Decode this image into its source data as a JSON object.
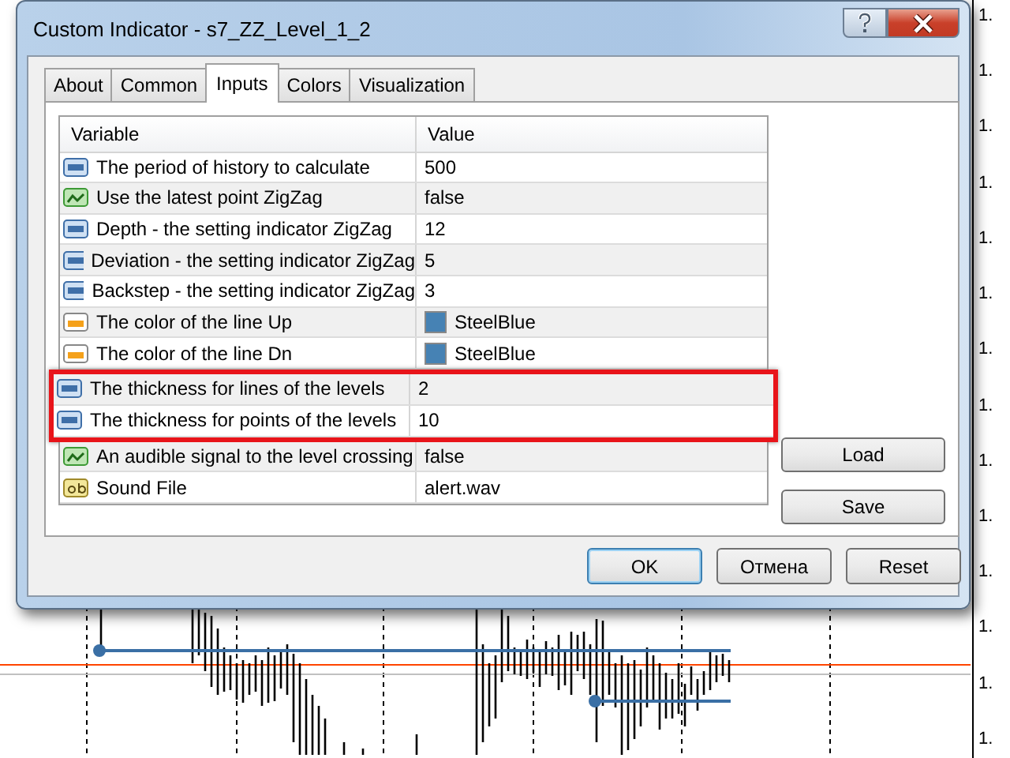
{
  "window": {
    "title": "Custom Indicator - s7_ZZ_Level_1_2"
  },
  "tabs": [
    {
      "label": "About",
      "selected": false
    },
    {
      "label": "Common",
      "selected": false
    },
    {
      "label": "Inputs",
      "selected": true
    },
    {
      "label": "Colors",
      "selected": false
    },
    {
      "label": "Visualization",
      "selected": false
    }
  ],
  "table": {
    "columns": [
      "Variable",
      "Value"
    ],
    "rows": [
      {
        "kind": "number",
        "variable": "The period of history to calculate",
        "value": "500",
        "highlighted": false
      },
      {
        "kind": "bool",
        "variable": "Use the latest point ZigZag",
        "value": "false",
        "highlighted": false
      },
      {
        "kind": "number",
        "variable": "Depth - the setting indicator ZigZag",
        "value": "12",
        "highlighted": false
      },
      {
        "kind": "number",
        "variable": "Deviation - the setting indicator ZigZag",
        "value": "5",
        "highlighted": false
      },
      {
        "kind": "number",
        "variable": "Backstep - the setting indicator ZigZag",
        "value": "3",
        "highlighted": false
      },
      {
        "kind": "color",
        "variable": "The color of the line Up",
        "value": "SteelBlue",
        "color": "#4682b4",
        "highlighted": false
      },
      {
        "kind": "color",
        "variable": "The color of the line Dn",
        "value": "SteelBlue",
        "color": "#4682b4",
        "highlighted": false
      },
      {
        "kind": "number",
        "variable": "The thickness for lines of the levels",
        "value": "2",
        "highlighted": true
      },
      {
        "kind": "number",
        "variable": "The thickness for points of the levels",
        "value": "10",
        "highlighted": true
      },
      {
        "kind": "bool",
        "variable": "An audible signal to the level crossing",
        "value": "false",
        "highlighted": false
      },
      {
        "kind": "string",
        "variable": "Sound File",
        "value": "alert.wav",
        "highlighted": false
      }
    ]
  },
  "side_buttons": [
    "Load",
    "Save"
  ],
  "buttons": [
    {
      "label": "OK",
      "default": true
    },
    {
      "label": "Отмена",
      "default": false
    },
    {
      "label": "Reset",
      "default": false
    }
  ],
  "price_axis": {
    "labels": [
      "1.",
      "1.",
      "1.",
      "1.",
      "1.",
      "1.",
      "1.",
      "1.",
      "1.",
      "1.",
      "1.",
      "1.",
      "1.",
      "1."
    ]
  }
}
